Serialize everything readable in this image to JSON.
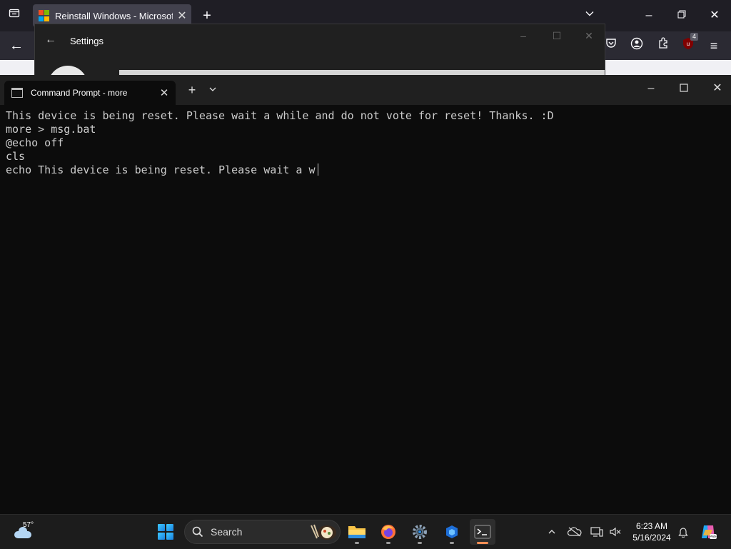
{
  "browser": {
    "tab_title": "Reinstall Windows - Microsoft S",
    "extension_badge": "4",
    "icons": [
      "tab-list-icon",
      "close-icon",
      "plus-icon",
      "chevron-down-icon",
      "minimize-icon",
      "restore-icon",
      "back-arrow-icon",
      "pocket-icon",
      "account-icon",
      "extensions-icon",
      "ublock-icon",
      "menu-icon"
    ]
  },
  "settings": {
    "title": "Settings"
  },
  "terminal": {
    "tab_title": "Command Prompt - more",
    "lines": [
      "This device is being reset. Please wait a while and do not vote for reset! Thanks. :D",
      "more > msg.bat",
      "@echo off",
      "cls",
      "echo This device is being reset. Please wait a w"
    ]
  },
  "taskbar": {
    "weather_temp": "57°",
    "search_label": "Search",
    "apps": [
      "start-button",
      "file-explorer",
      "firefox",
      "settings",
      "azure-data-studio",
      "terminal"
    ],
    "clock_time": "6:23 AM",
    "clock_date": "5/16/2024",
    "accent": "#ff8f55"
  }
}
